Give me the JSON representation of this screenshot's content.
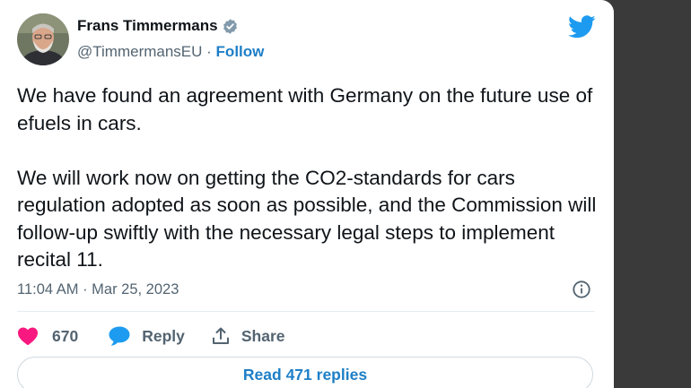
{
  "tweet": {
    "author": {
      "name": "Frans Timmermans",
      "handle": "@TimmermansEU",
      "separator": "·",
      "follow_label": "Follow"
    },
    "paragraphs": [
      "We have found an agreement with Germany on the future use of efuels in cars.",
      "We will work now on getting the CO2-standards for cars regulation adopted as soon as possible, and the Commission will follow-up swiftly with the necessary legal steps to implement recital 11."
    ],
    "timestamp": "11:04 AM · Mar 25, 2023",
    "actions": {
      "like_count": "670",
      "reply_label": "Reply",
      "share_label": "Share"
    },
    "read_replies_label": "Read 471 replies"
  },
  "colors": {
    "brand_blue": "#1d9bf0",
    "link_blue": "#1d7fc7",
    "like_pink": "#f91880",
    "text_primary": "#0f1419",
    "text_secondary": "#536471"
  },
  "icons": {
    "verified": "verified-badge-icon",
    "brand": "twitter-bird-icon",
    "info": "info-icon",
    "like": "heart-icon",
    "reply": "speech-bubble-icon",
    "share": "share-upload-icon"
  }
}
